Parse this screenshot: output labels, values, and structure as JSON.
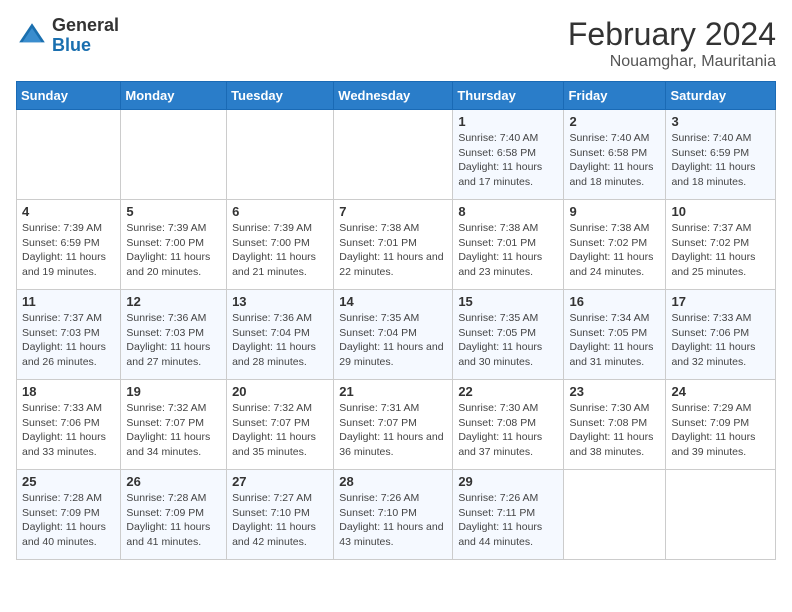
{
  "header": {
    "logo": {
      "general": "General",
      "blue": "Blue"
    },
    "title": "February 2024",
    "subtitle": "Nouamghar, Mauritania"
  },
  "days_of_week": [
    "Sunday",
    "Monday",
    "Tuesday",
    "Wednesday",
    "Thursday",
    "Friday",
    "Saturday"
  ],
  "weeks": [
    [
      {
        "day": "",
        "info": ""
      },
      {
        "day": "",
        "info": ""
      },
      {
        "day": "",
        "info": ""
      },
      {
        "day": "",
        "info": ""
      },
      {
        "day": "1",
        "info": "Sunrise: 7:40 AM\nSunset: 6:58 PM\nDaylight: 11 hours and 17 minutes."
      },
      {
        "day": "2",
        "info": "Sunrise: 7:40 AM\nSunset: 6:58 PM\nDaylight: 11 hours and 18 minutes."
      },
      {
        "day": "3",
        "info": "Sunrise: 7:40 AM\nSunset: 6:59 PM\nDaylight: 11 hours and 18 minutes."
      }
    ],
    [
      {
        "day": "4",
        "info": "Sunrise: 7:39 AM\nSunset: 6:59 PM\nDaylight: 11 hours and 19 minutes."
      },
      {
        "day": "5",
        "info": "Sunrise: 7:39 AM\nSunset: 7:00 PM\nDaylight: 11 hours and 20 minutes."
      },
      {
        "day": "6",
        "info": "Sunrise: 7:39 AM\nSunset: 7:00 PM\nDaylight: 11 hours and 21 minutes."
      },
      {
        "day": "7",
        "info": "Sunrise: 7:38 AM\nSunset: 7:01 PM\nDaylight: 11 hours and 22 minutes."
      },
      {
        "day": "8",
        "info": "Sunrise: 7:38 AM\nSunset: 7:01 PM\nDaylight: 11 hours and 23 minutes."
      },
      {
        "day": "9",
        "info": "Sunrise: 7:38 AM\nSunset: 7:02 PM\nDaylight: 11 hours and 24 minutes."
      },
      {
        "day": "10",
        "info": "Sunrise: 7:37 AM\nSunset: 7:02 PM\nDaylight: 11 hours and 25 minutes."
      }
    ],
    [
      {
        "day": "11",
        "info": "Sunrise: 7:37 AM\nSunset: 7:03 PM\nDaylight: 11 hours and 26 minutes."
      },
      {
        "day": "12",
        "info": "Sunrise: 7:36 AM\nSunset: 7:03 PM\nDaylight: 11 hours and 27 minutes."
      },
      {
        "day": "13",
        "info": "Sunrise: 7:36 AM\nSunset: 7:04 PM\nDaylight: 11 hours and 28 minutes."
      },
      {
        "day": "14",
        "info": "Sunrise: 7:35 AM\nSunset: 7:04 PM\nDaylight: 11 hours and 29 minutes."
      },
      {
        "day": "15",
        "info": "Sunrise: 7:35 AM\nSunset: 7:05 PM\nDaylight: 11 hours and 30 minutes."
      },
      {
        "day": "16",
        "info": "Sunrise: 7:34 AM\nSunset: 7:05 PM\nDaylight: 11 hours and 31 minutes."
      },
      {
        "day": "17",
        "info": "Sunrise: 7:33 AM\nSunset: 7:06 PM\nDaylight: 11 hours and 32 minutes."
      }
    ],
    [
      {
        "day": "18",
        "info": "Sunrise: 7:33 AM\nSunset: 7:06 PM\nDaylight: 11 hours and 33 minutes."
      },
      {
        "day": "19",
        "info": "Sunrise: 7:32 AM\nSunset: 7:07 PM\nDaylight: 11 hours and 34 minutes."
      },
      {
        "day": "20",
        "info": "Sunrise: 7:32 AM\nSunset: 7:07 PM\nDaylight: 11 hours and 35 minutes."
      },
      {
        "day": "21",
        "info": "Sunrise: 7:31 AM\nSunset: 7:07 PM\nDaylight: 11 hours and 36 minutes."
      },
      {
        "day": "22",
        "info": "Sunrise: 7:30 AM\nSunset: 7:08 PM\nDaylight: 11 hours and 37 minutes."
      },
      {
        "day": "23",
        "info": "Sunrise: 7:30 AM\nSunset: 7:08 PM\nDaylight: 11 hours and 38 minutes."
      },
      {
        "day": "24",
        "info": "Sunrise: 7:29 AM\nSunset: 7:09 PM\nDaylight: 11 hours and 39 minutes."
      }
    ],
    [
      {
        "day": "25",
        "info": "Sunrise: 7:28 AM\nSunset: 7:09 PM\nDaylight: 11 hours and 40 minutes."
      },
      {
        "day": "26",
        "info": "Sunrise: 7:28 AM\nSunset: 7:09 PM\nDaylight: 11 hours and 41 minutes."
      },
      {
        "day": "27",
        "info": "Sunrise: 7:27 AM\nSunset: 7:10 PM\nDaylight: 11 hours and 42 minutes."
      },
      {
        "day": "28",
        "info": "Sunrise: 7:26 AM\nSunset: 7:10 PM\nDaylight: 11 hours and 43 minutes."
      },
      {
        "day": "29",
        "info": "Sunrise: 7:26 AM\nSunset: 7:11 PM\nDaylight: 11 hours and 44 minutes."
      },
      {
        "day": "",
        "info": ""
      },
      {
        "day": "",
        "info": ""
      }
    ]
  ]
}
